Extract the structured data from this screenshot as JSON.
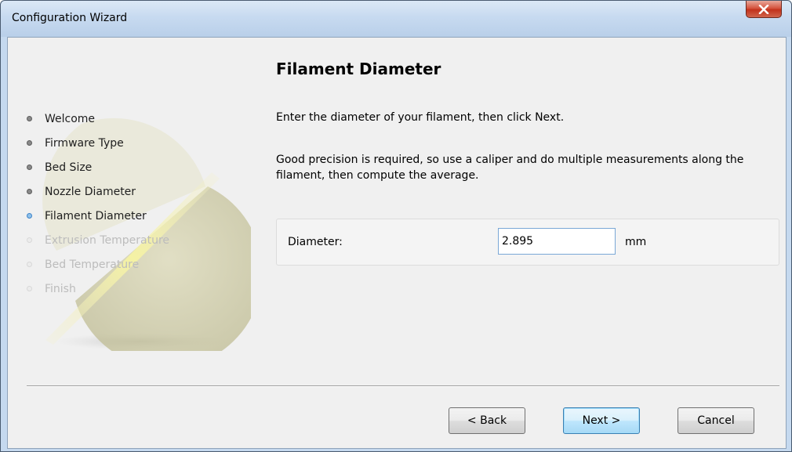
{
  "window": {
    "title": "Configuration Wizard",
    "close_icon": "close-icon"
  },
  "sidebar": {
    "steps": [
      {
        "label": "Welcome",
        "state": "done"
      },
      {
        "label": "Firmware Type",
        "state": "done"
      },
      {
        "label": "Bed Size",
        "state": "done"
      },
      {
        "label": "Nozzle Diameter",
        "state": "done"
      },
      {
        "label": "Filament Diameter",
        "state": "active"
      },
      {
        "label": "Extrusion Temperature",
        "state": "pending"
      },
      {
        "label": "Bed Temperature",
        "state": "pending"
      },
      {
        "label": "Finish",
        "state": "pending"
      }
    ]
  },
  "page": {
    "title": "Filament Diameter",
    "description1": "Enter the diameter of your filament, then click Next.",
    "description2": "Good precision is required, so use a caliper and do multiple measurements along the filament, then compute the average."
  },
  "field": {
    "label": "Diameter:",
    "value": "2.895",
    "unit": "mm"
  },
  "buttons": {
    "back": "< Back",
    "next": "Next >",
    "cancel": "Cancel"
  },
  "colors": {
    "active_step": "#3d83c8",
    "default_button_border": "#3c7fb1",
    "close_button": "#c2321c"
  }
}
